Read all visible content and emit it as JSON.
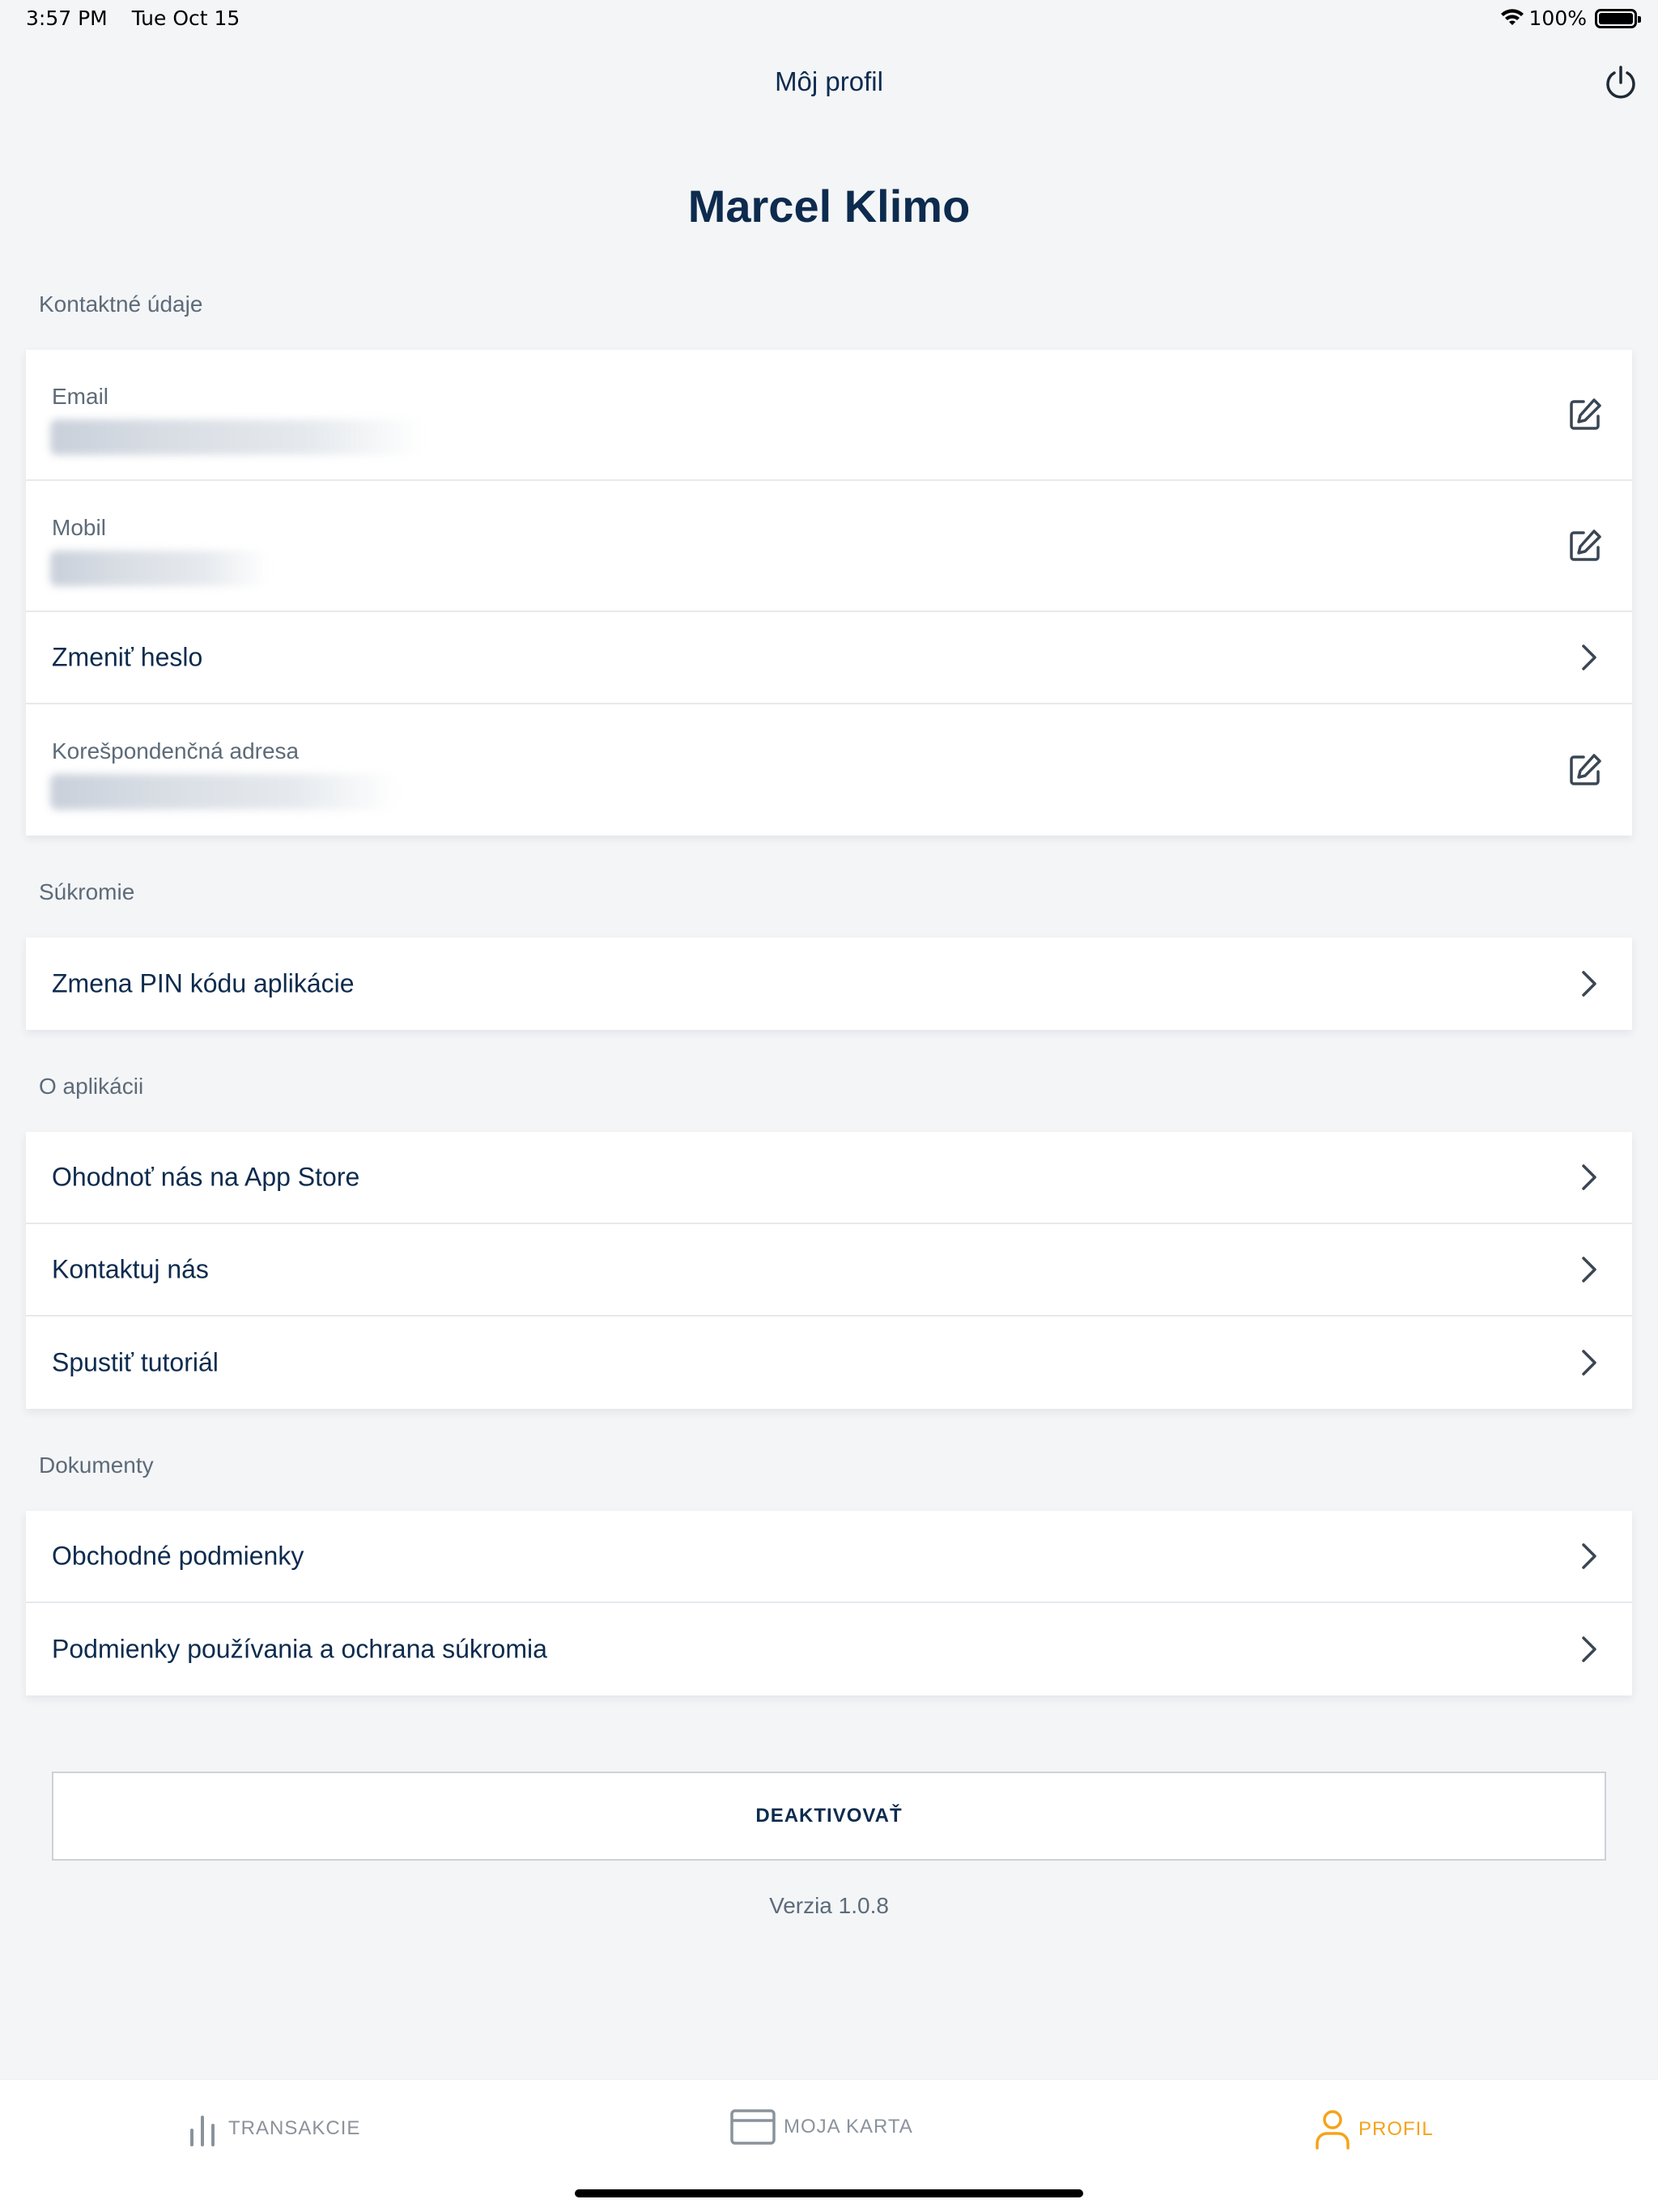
{
  "status_bar": {
    "time": "3:57 PM",
    "date": "Tue Oct 15",
    "battery": "100%"
  },
  "nav": {
    "title": "Môj profil",
    "power_icon": "power-icon"
  },
  "profile": {
    "name": "Marcel Klimo"
  },
  "sections": {
    "contact": {
      "label": "Kontaktné údaje",
      "email_label": "Email",
      "mobile_label": "Mobil",
      "change_password": "Zmeniť heslo",
      "address_label": "Korešpondenčná adresa"
    },
    "privacy": {
      "label": "Súkromie",
      "change_pin": "Zmena PIN kódu aplikácie"
    },
    "about": {
      "label": "O aplikácii",
      "rate_app": "Ohodnoť nás na App Store",
      "contact_us": "Kontaktuj nás",
      "tutorial": "Spustiť tutoriál"
    },
    "documents": {
      "label": "Dokumenty",
      "terms": "Obchodné podmienky",
      "privacy_terms": "Podmienky používania a ochrana súkromia"
    }
  },
  "deactivate_label": "DEAKTIVOVAŤ",
  "version": "Verzia 1.0.8",
  "tabs": [
    {
      "label": "TRANSAKCIE",
      "icon": "bar-chart-icon",
      "active": false
    },
    {
      "label": "MOJA KARTA",
      "icon": "card-icon",
      "active": false
    },
    {
      "label": "PROFIL",
      "icon": "user-icon",
      "active": true
    }
  ],
  "colors": {
    "primary_text": "#0d2b4e",
    "secondary_text": "#5d6b79",
    "accent": "#f5a31a",
    "background": "#f4f5f7"
  }
}
